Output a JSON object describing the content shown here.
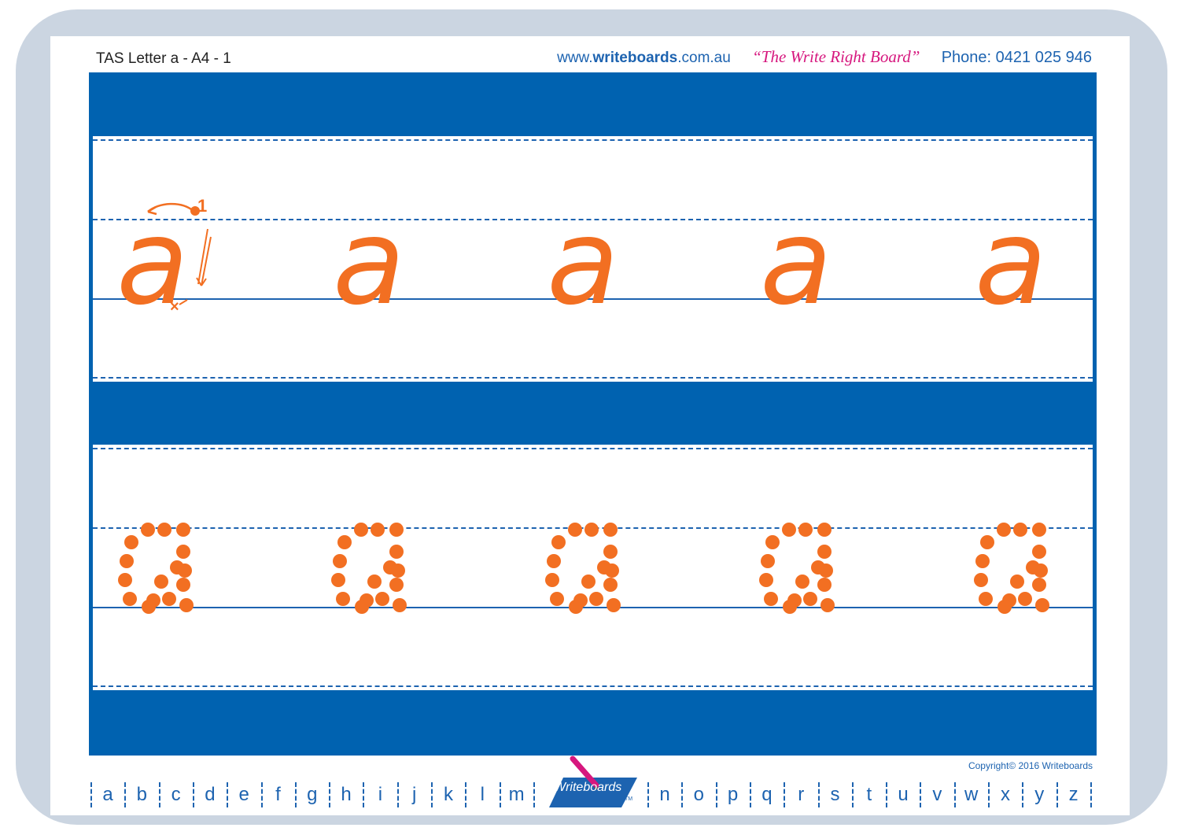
{
  "header": {
    "sheet_title": "TAS Letter a - A4 - 1",
    "site_prefix": "www.",
    "site_brand": "writeboards",
    "site_suffix": ".com.au",
    "slogan": "“The Write Right Board”",
    "phone": "Phone: 0421 025 946"
  },
  "practice": {
    "letter": "a",
    "stroke_number": "1",
    "end_mark": "×"
  },
  "footer": {
    "copyright": "Copyright© 2016  Writeboards",
    "logo_text": "Writeboards",
    "logo_tm": "TM",
    "alphabet": [
      "a",
      "b",
      "c",
      "d",
      "e",
      "f",
      "g",
      "h",
      "i",
      "j",
      "k",
      "l",
      "m",
      "n",
      "o",
      "p",
      "q",
      "r",
      "s",
      "t",
      "u",
      "v",
      "w",
      "x",
      "y",
      "z"
    ]
  },
  "colors": {
    "board_blue": "#0062b0",
    "line_blue": "#1d63b0",
    "letter_orange": "#f26f22",
    "slogan_pink": "#d6177e",
    "frame_grey": "#cbd5e1"
  }
}
